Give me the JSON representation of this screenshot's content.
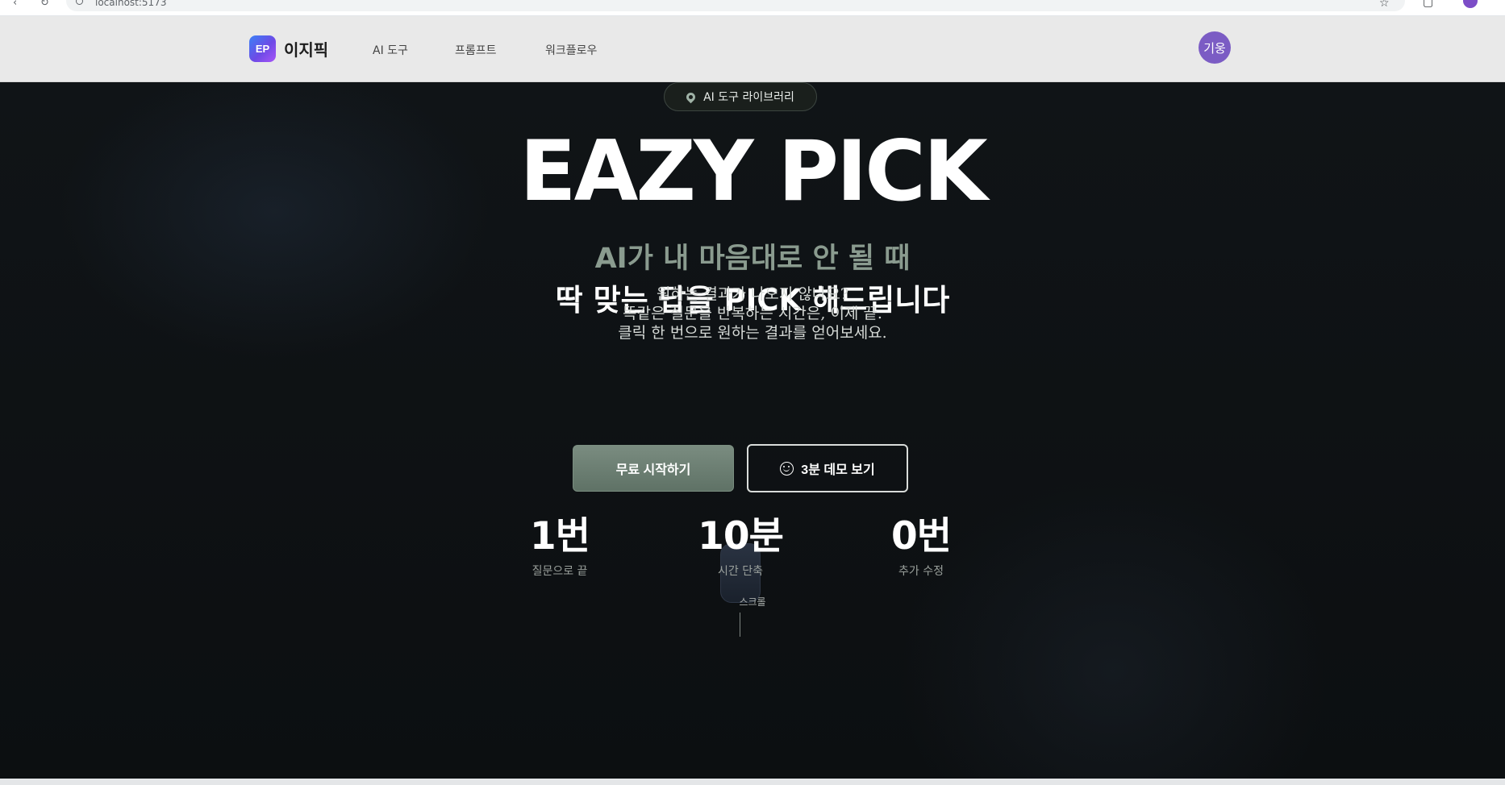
{
  "browser": {
    "url": "localhost:5173"
  },
  "header": {
    "logo_badge": "EP",
    "logo_text": "이지픽",
    "nav": [
      {
        "label": "AI 도구"
      },
      {
        "label": "프롬프트"
      },
      {
        "label": "워크플로우"
      }
    ],
    "user_avatar": "기웅"
  },
  "hero": {
    "badge_label": "AI 도구 라이브러리",
    "title": "EAZY PICK",
    "tagline_1": "AI가 내 마음대로 안 될 때",
    "tagline_2": "딱 맞는 답을 PICK 해드립니다",
    "description": [
      "원하는 결과가 나오지 않나요?",
      "똑같은 질문을 반복하는 시간은, 이제 끝.",
      "클릭 한 번으로 원하는 결과를 얻어보세요."
    ],
    "primary_button": "무료 시작하기",
    "secondary_button": "3분 데모 보기",
    "stats": [
      {
        "value": "1번",
        "label": "질문으로 끝"
      },
      {
        "value": "10분",
        "label": "시간 단축"
      },
      {
        "value": "0번",
        "label": "추가 수정"
      }
    ],
    "scroll_label": "스크롤"
  },
  "colors": {
    "accent": "#6e8174",
    "hero_bg": "#0f1214",
    "header_bg": "#e9e9e9",
    "avatar": "#7b5cc4"
  }
}
